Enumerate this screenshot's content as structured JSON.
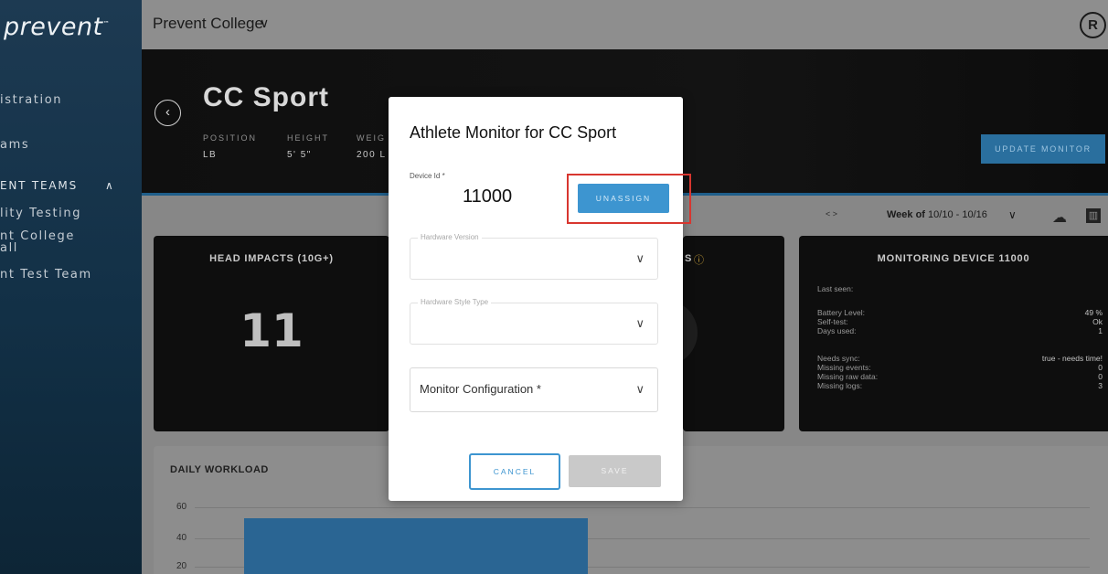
{
  "app": {
    "logo_text": "prevent",
    "logo_tm": "™"
  },
  "sidebar": {
    "items": [
      {
        "label": "istration"
      },
      {
        "label": "ams"
      }
    ],
    "section_label": "ENT TEAMS",
    "team_items": [
      {
        "label": "lity Testing"
      },
      {
        "label": "nt College"
      },
      {
        "label": "all"
      },
      {
        "label": "nt Test Team"
      }
    ]
  },
  "topbar": {
    "org_name": "Prevent College",
    "org_chevron": "∨",
    "user_icon": "user-circle-icon"
  },
  "hero": {
    "athlete_name": "CC Sport",
    "stats": [
      {
        "label": "POSITION",
        "value": "LB"
      },
      {
        "label": "HEIGHT",
        "value": "5' 5\""
      },
      {
        "label": "WEIG",
        "value": "200 L"
      }
    ],
    "update_monitor_label": "UPDATE MONITOR",
    "back_glyph": "‹"
  },
  "week": {
    "arrows": "< >",
    "prefix": "Week of",
    "range": "10/10 - 10/16",
    "chevron": "∨"
  },
  "cards": {
    "head_impacts": {
      "title": "HEAD IMPACTS (10G+)",
      "value": "11"
    },
    "middle_partial": {
      "title_fragment": "S",
      "info_glyph": "ⓘ"
    },
    "monitoring": {
      "title": "MONITORING DEVICE 11000",
      "last_seen_label": "Last seen:",
      "group1": [
        {
          "label": "Battery Level:",
          "value": "49 %"
        },
        {
          "label": "Self-test:",
          "value": "Ok"
        },
        {
          "label": "Days used:",
          "value": "1"
        }
      ],
      "group2": [
        {
          "label": "Needs sync:",
          "value": "true - needs time!"
        },
        {
          "label": "Missing events:",
          "value": "0"
        },
        {
          "label": "Missing raw data:",
          "value": "0"
        },
        {
          "label": "Missing logs:",
          "value": "3"
        }
      ]
    }
  },
  "workload": {
    "title": "DAILY WORKLOAD",
    "ticks": [
      "60",
      "40",
      "20"
    ]
  },
  "modal": {
    "title": "Athlete Monitor for CC Sport",
    "device_id_label": "Device Id *",
    "device_id_value": "11000",
    "unassign_label": "UNASSIGN",
    "hardware_version_label": "Hardware Version",
    "hardware_style_label": "Hardware Style Type",
    "monitor_config_placeholder": "Monitor Configuration *",
    "chevron": "∨",
    "cancel_label": "CANCEL",
    "save_label": "SAVE"
  },
  "colors": {
    "accent_blue": "#3d95d0",
    "highlight_red": "#d8362f",
    "sidebar_bg": "#1d3a52"
  }
}
